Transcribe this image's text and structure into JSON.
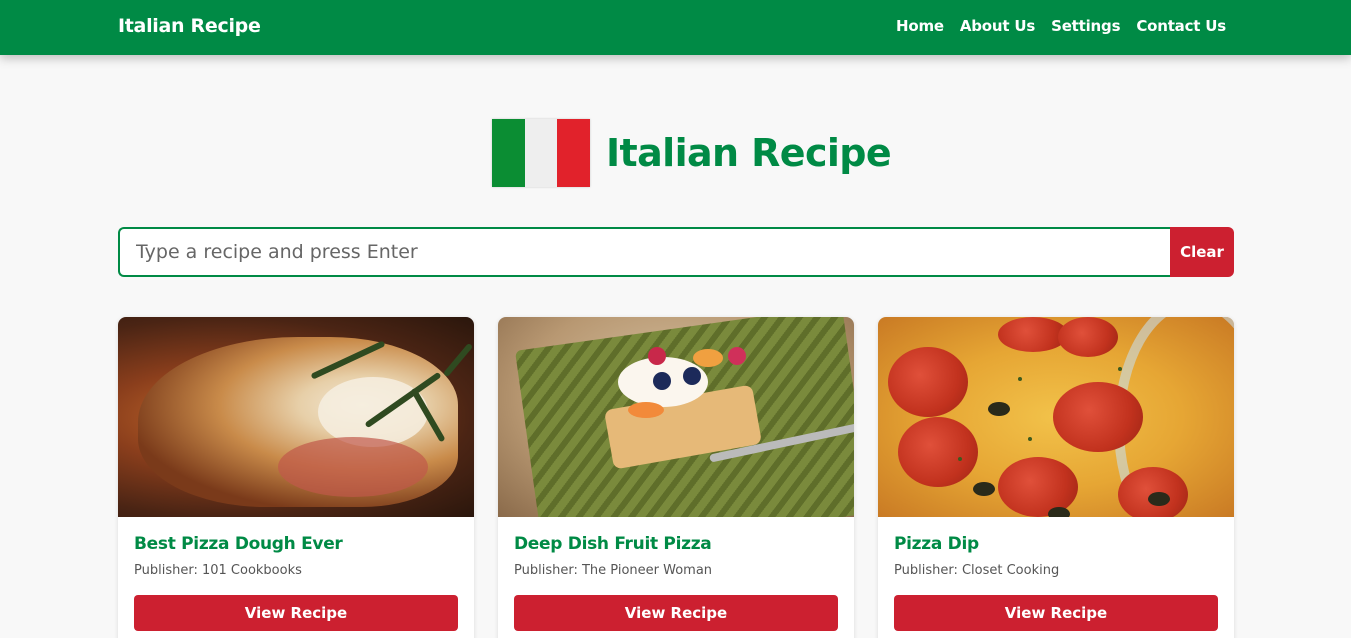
{
  "navbar": {
    "brand": "Italian Recipe",
    "links": [
      "Home",
      "About Us",
      "Settings",
      "Contact Us"
    ]
  },
  "hero": {
    "title": "Italian Recipe",
    "flag_colors": [
      "#0b8d33",
      "#eeeeee",
      "#e1222b"
    ]
  },
  "search": {
    "placeholder": "Type a recipe and press Enter",
    "value": "",
    "clear_label": "Clear"
  },
  "recipes": [
    {
      "title": "Best Pizza Dough Ever",
      "publisher": "Publisher: 101 Cookbooks",
      "button": "View Recipe"
    },
    {
      "title": "Deep Dish Fruit Pizza",
      "publisher": "Publisher: The Pioneer Woman",
      "button": "View Recipe"
    },
    {
      "title": "Pizza Dip",
      "publisher": "Publisher: Closet Cooking",
      "button": "View Recipe"
    }
  ],
  "colors": {
    "primary_green": "#008a45",
    "accent_red": "#cc2030",
    "background": "#f8f8f8"
  }
}
